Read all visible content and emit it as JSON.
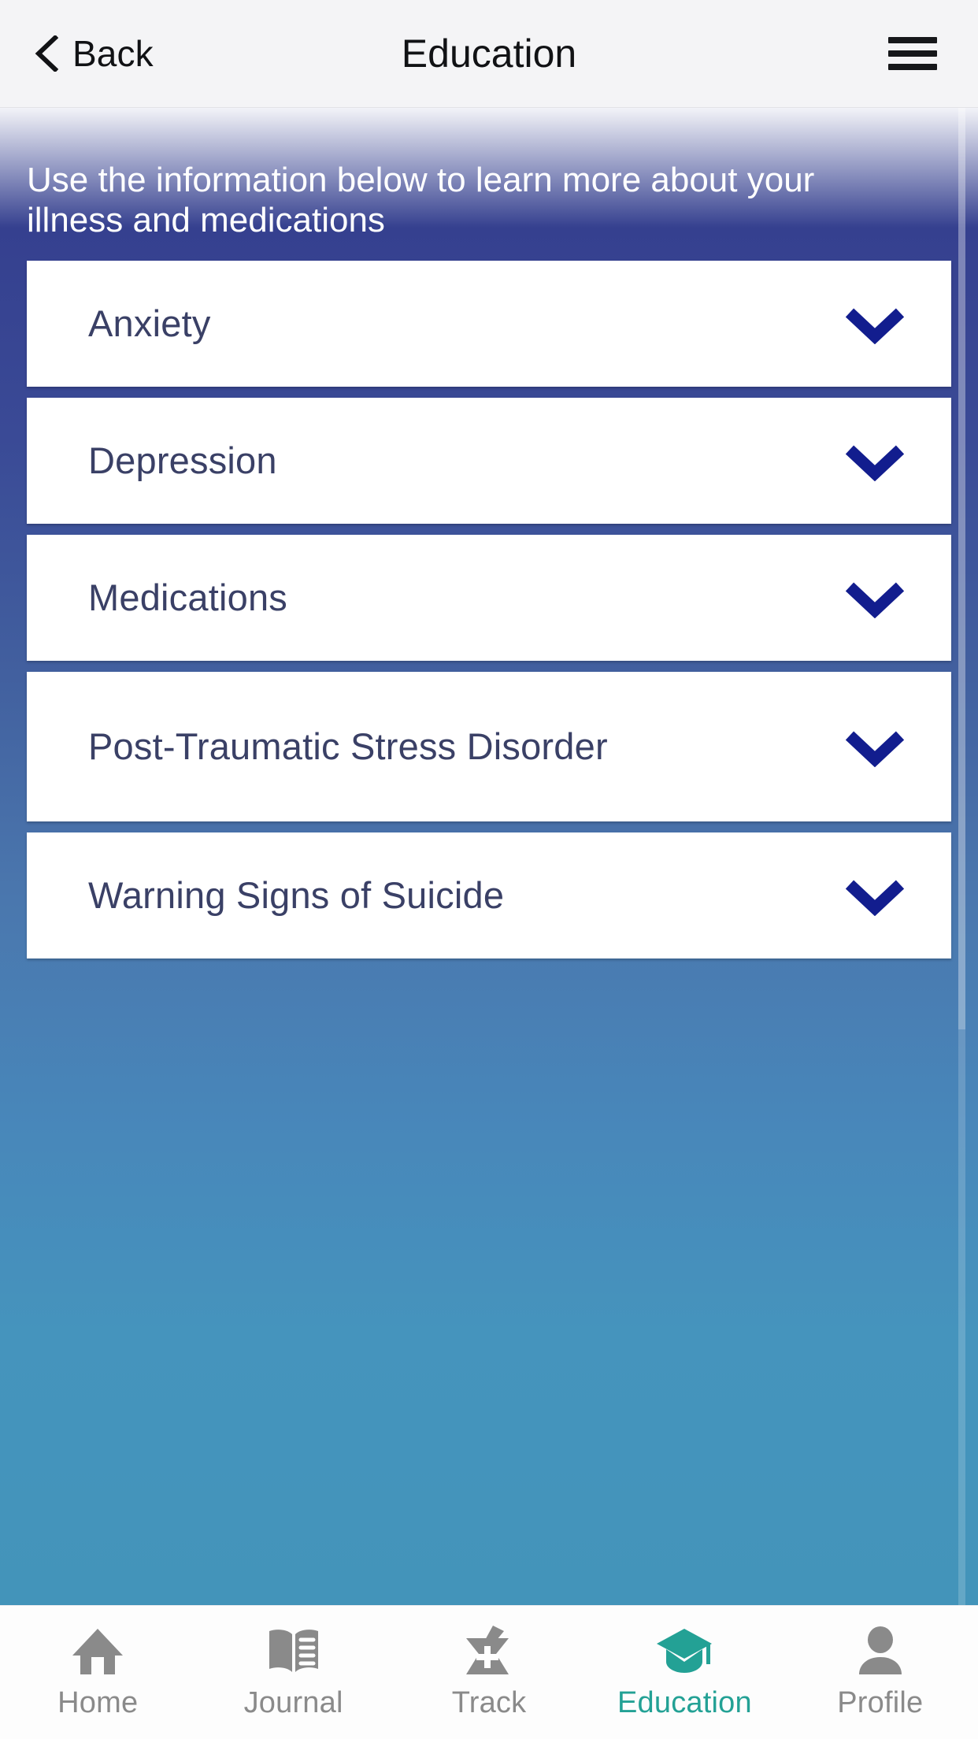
{
  "header": {
    "back_label": "Back",
    "title": "Education",
    "back_icon": "chevron-left-icon",
    "menu_icon": "hamburger-menu-icon"
  },
  "main": {
    "intro_text": "Use the information below to learn more about your illness and medications",
    "accent_blue": "#35408f",
    "gradient_end": "#4394ba",
    "card_text_color": "#3a4066",
    "chevron_color": "#121d8e",
    "cards": [
      {
        "label": "Anxiety",
        "icon": "chevron-down-icon"
      },
      {
        "label": "Depression",
        "icon": "chevron-down-icon"
      },
      {
        "label": "Medications",
        "icon": "chevron-down-icon"
      },
      {
        "label": "Post-Traumatic Stress Disorder",
        "icon": "chevron-down-icon"
      },
      {
        "label": "Warning Signs of Suicide",
        "icon": "chevron-down-icon"
      }
    ]
  },
  "bottom_nav": {
    "active_color": "#23a195",
    "inactive_color": "#8a8a8a",
    "items": [
      {
        "label": "Home",
        "icon": "home-icon",
        "active": false
      },
      {
        "label": "Journal",
        "icon": "book-icon",
        "active": false
      },
      {
        "label": "Track",
        "icon": "mortar-pestle-icon",
        "active": false
      },
      {
        "label": "Education",
        "icon": "graduation-cap-icon",
        "active": true
      },
      {
        "label": "Profile",
        "icon": "person-icon",
        "active": false
      }
    ]
  }
}
